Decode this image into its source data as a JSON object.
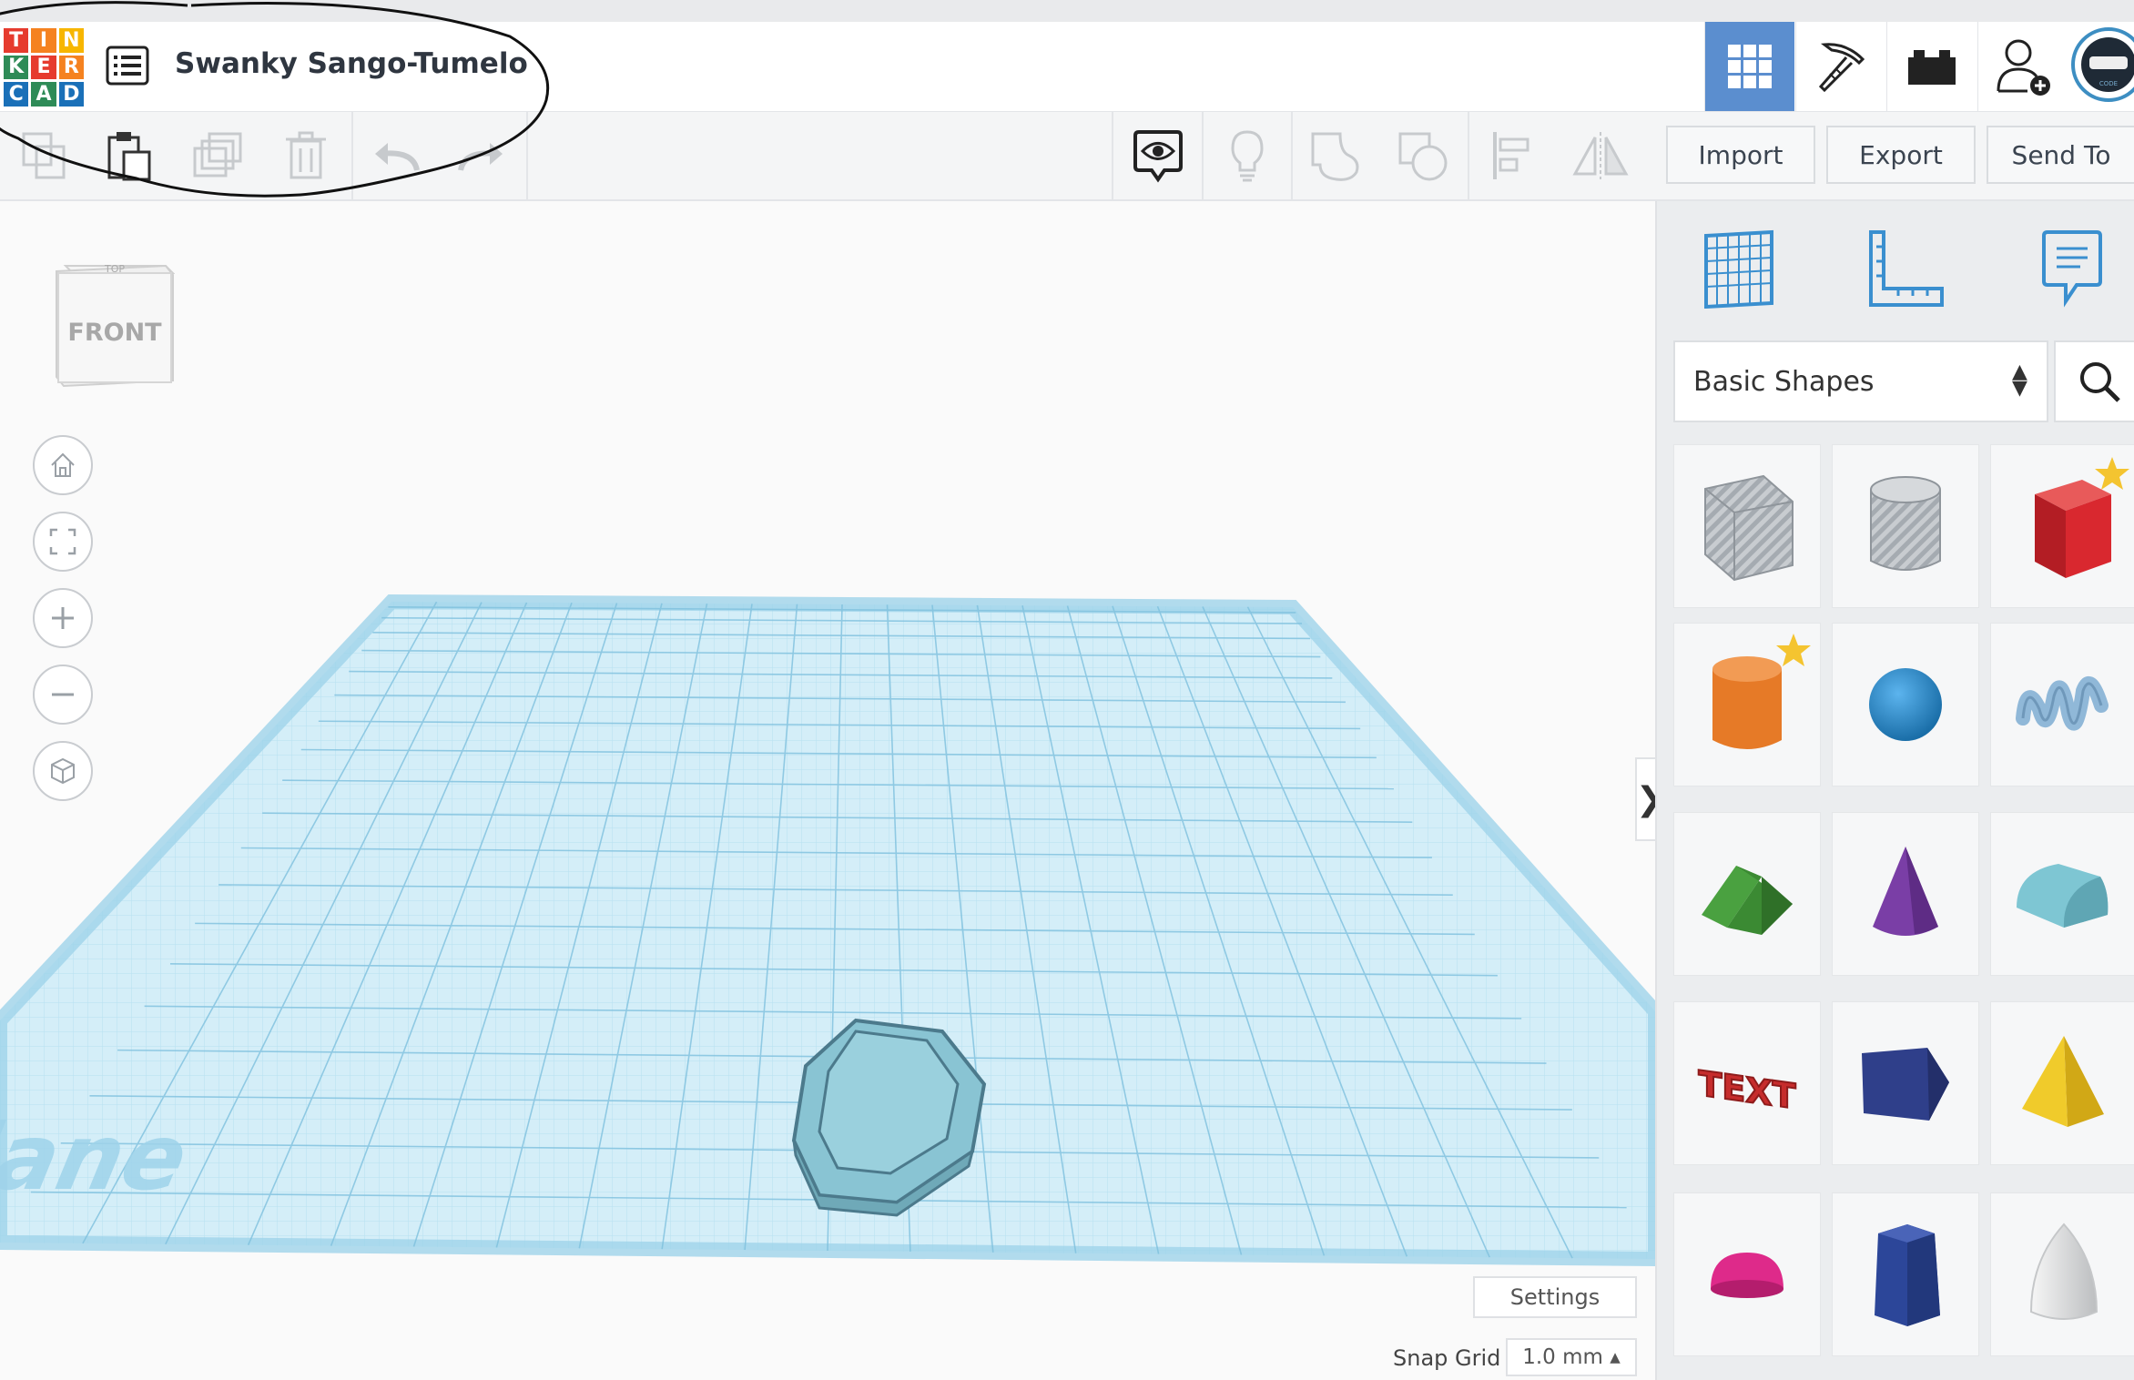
{
  "logo": {
    "letters": [
      "T",
      "I",
      "N",
      "K",
      "E",
      "R",
      "C",
      "A",
      "D"
    ],
    "colors": [
      "#e63b2e",
      "#f58220",
      "#f7b600",
      "#2e8b57",
      "#e63b2e",
      "#f58220",
      "#1a70b8",
      "#2e8b57",
      "#1a70b8"
    ]
  },
  "header": {
    "title": "Swanky Sango-Tumelo",
    "accent": "#5b8ecf"
  },
  "toolbar": {
    "import_label": "Import",
    "export_label": "Export",
    "send_to_label": "Send To"
  },
  "viewcube": {
    "top_label": "TOP",
    "front_label": "FRONT"
  },
  "workplane": {
    "label": "Workplane",
    "grid_color": "#9ed3ea"
  },
  "panel_toggle": "❯",
  "shapes_panel": {
    "category": "Basic Shapes",
    "shapes": [
      {
        "icon": "box-hole-icon",
        "color": "#b9bec4"
      },
      {
        "icon": "cylinder-hole-icon",
        "color": "#c3c7cb"
      },
      {
        "icon": "box-icon",
        "color": "#d9282f",
        "starred": true
      },
      {
        "icon": "cylinder-icon",
        "color": "#e67a27",
        "starred": true
      },
      {
        "icon": "sphere-icon",
        "color": "#2d8ed4"
      },
      {
        "icon": "scribble-icon",
        "color": "#90b8d8"
      },
      {
        "icon": "roof-icon",
        "color": "#4aa140"
      },
      {
        "icon": "cone-icon",
        "color": "#7a3ea6"
      },
      {
        "icon": "round-roof-icon",
        "color": "#7ec6d3"
      },
      {
        "icon": "text-icon",
        "color": "#c62c2c"
      },
      {
        "icon": "wedge-icon",
        "color": "#2f3f8a"
      },
      {
        "icon": "pyramid-icon",
        "color": "#f0cb2b"
      },
      {
        "icon": "half-sphere-icon",
        "color": "#de2a8a"
      },
      {
        "icon": "polygon-icon",
        "color": "#2c4699"
      },
      {
        "icon": "paraboloid-icon",
        "color": "#e6e7e8"
      }
    ],
    "text_tile_label": "TEXT"
  },
  "footer": {
    "settings_label": "Settings",
    "snap_grid_label": "Snap Grid",
    "snap_grid_value": "1.0 mm ▴"
  }
}
